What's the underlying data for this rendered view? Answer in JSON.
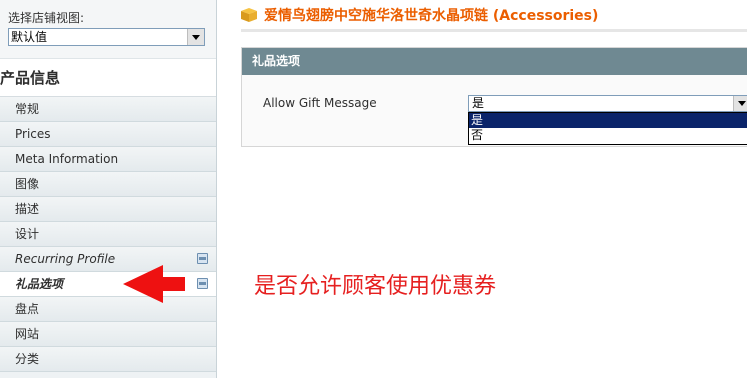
{
  "store_switcher": {
    "label": "选择店铺视图:",
    "value": "默认值"
  },
  "sidebar": {
    "title": "产品信息",
    "items": [
      {
        "label": "常规"
      },
      {
        "label": "Prices"
      },
      {
        "label": "Meta Information"
      },
      {
        "label": "图像"
      },
      {
        "label": "描述"
      },
      {
        "label": "设计"
      },
      {
        "label": "Recurring Profile"
      },
      {
        "label": "礼品选项"
      },
      {
        "label": "盘点"
      },
      {
        "label": "网站"
      },
      {
        "label": "分类"
      }
    ]
  },
  "header": {
    "title": "爱情鸟翅膀中空施华洛世奇水晶项链 (Accessories)",
    "icon": "package-icon"
  },
  "fieldset": {
    "title": "礼品选项",
    "field_label": "Allow Gift Message",
    "selected_value": "是",
    "options": [
      "是",
      "否"
    ]
  },
  "annotation": "是否允许顾客使用优惠券",
  "colors": {
    "title_orange": "#eb5e00",
    "fieldset_header": "#6f8992",
    "annotation_red": "#e62020",
    "selected_option": "#0a246a"
  }
}
